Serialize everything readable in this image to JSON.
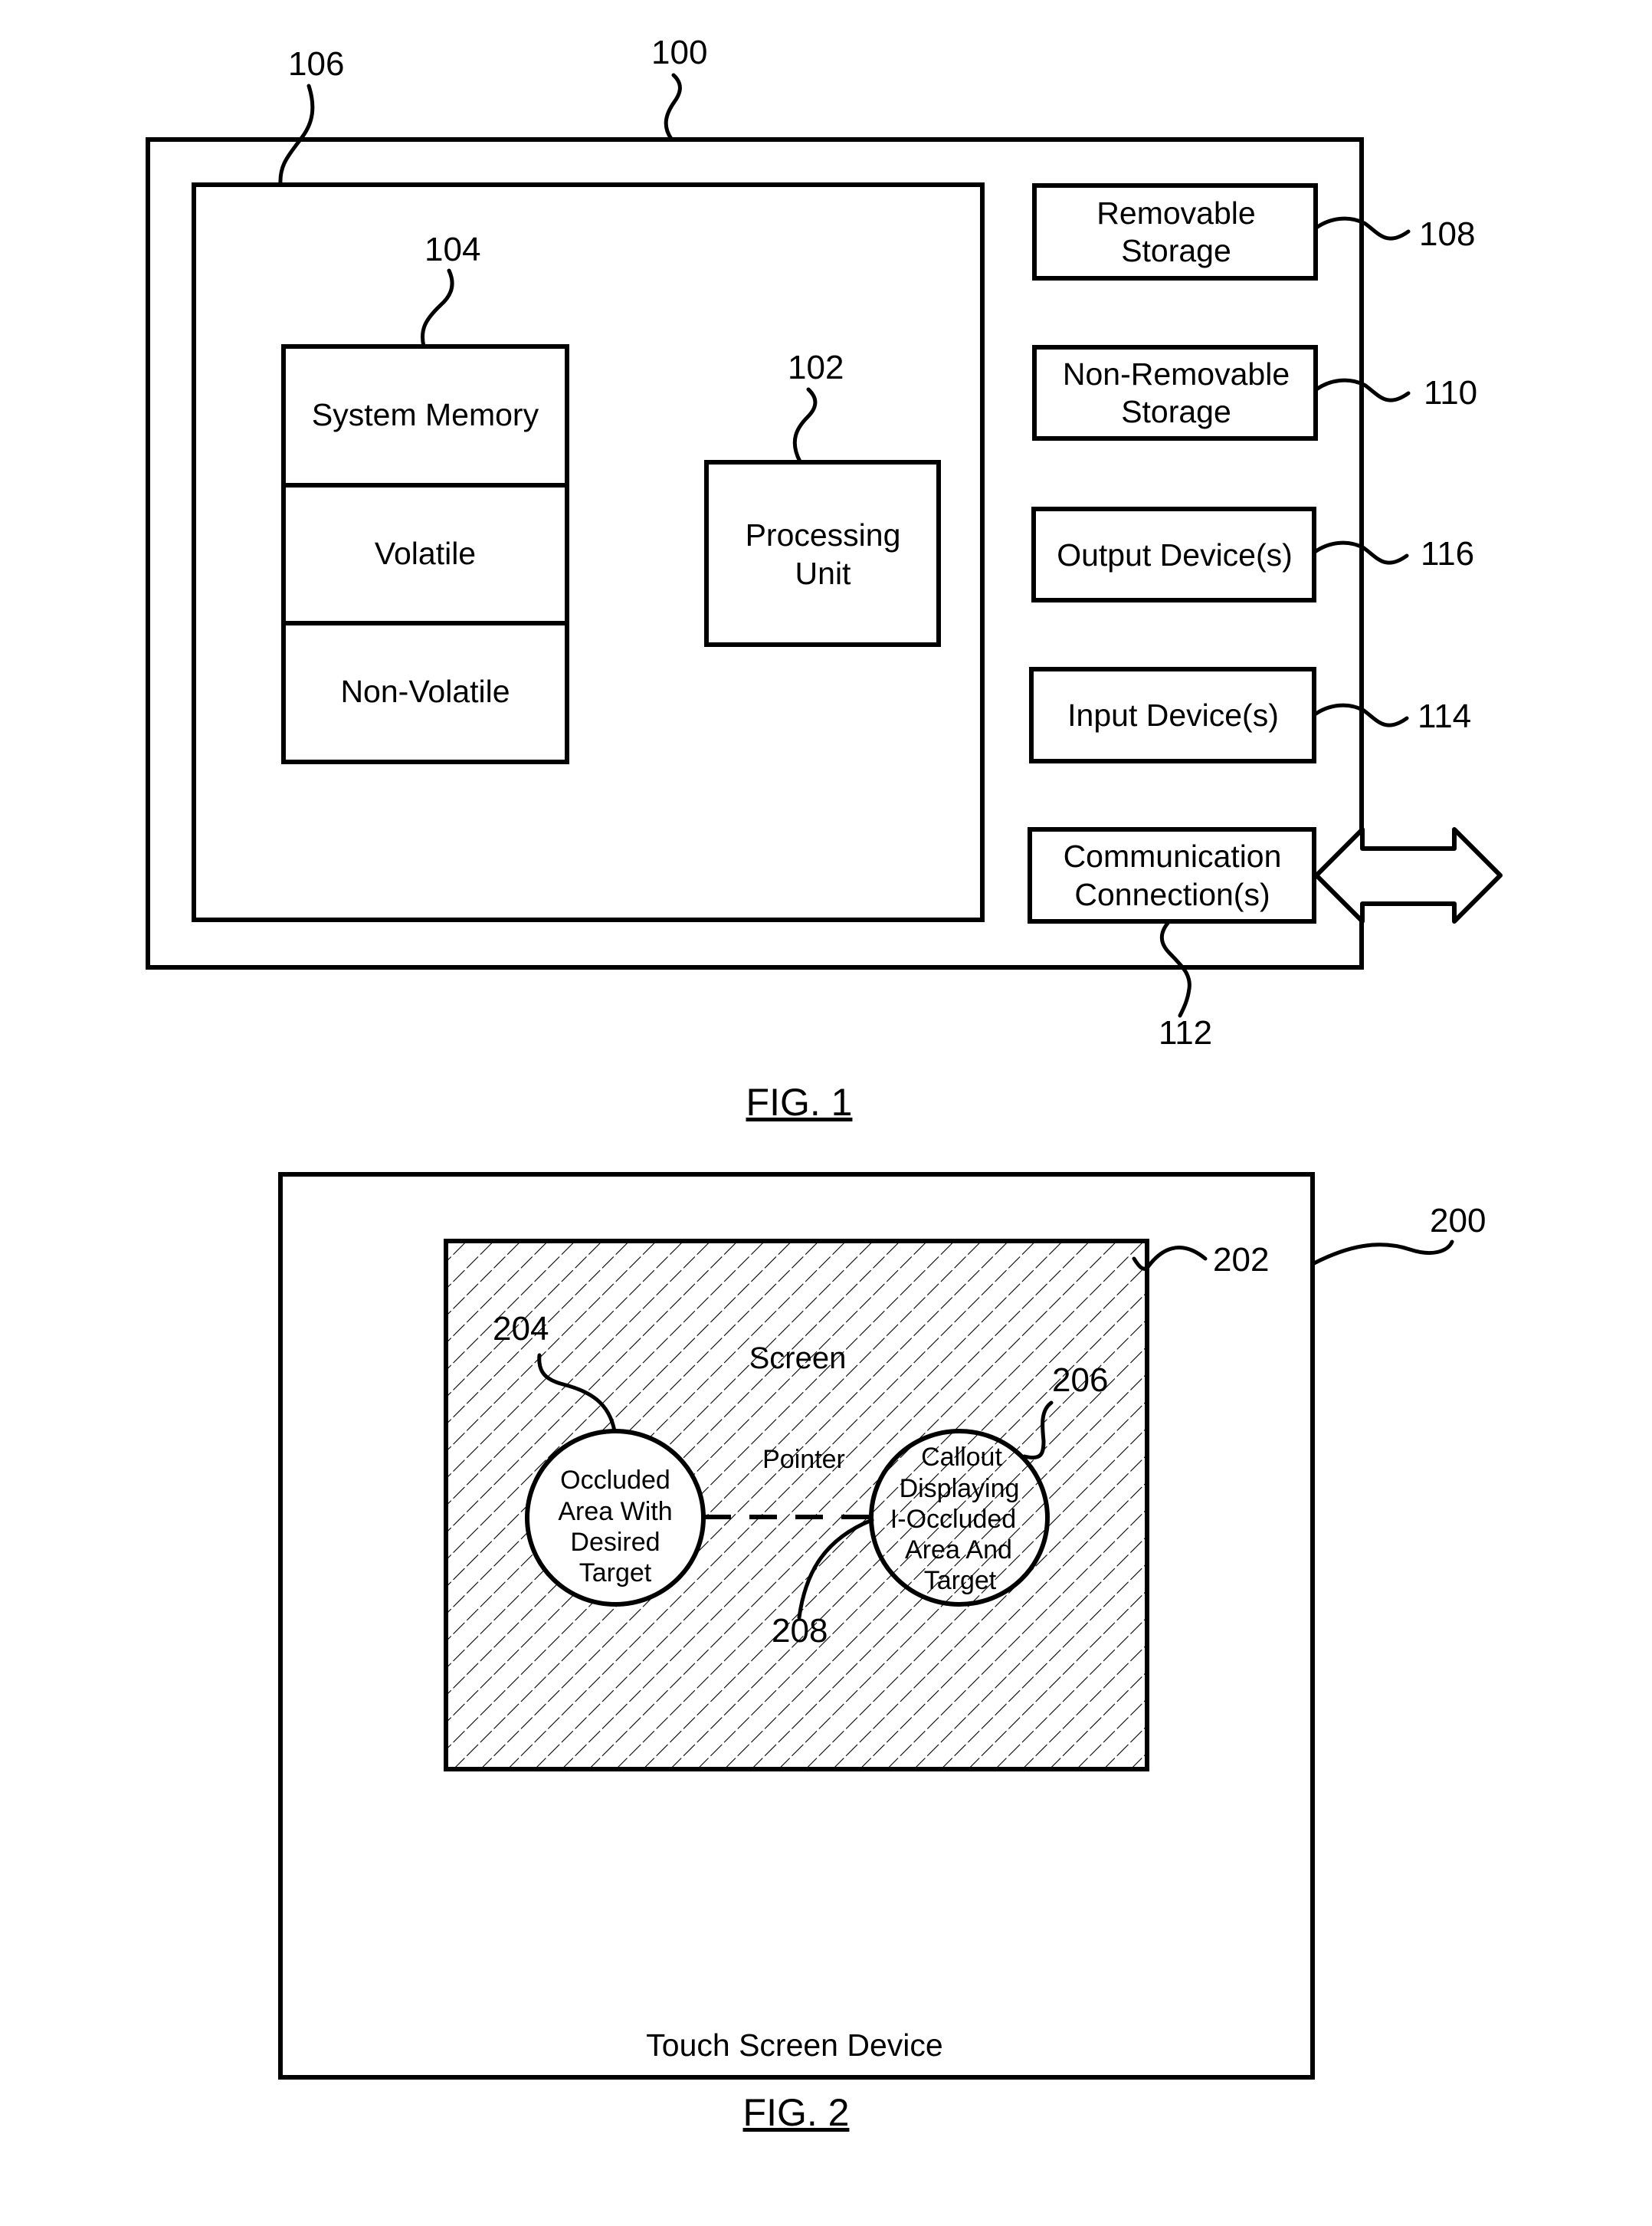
{
  "figure1": {
    "caption": "FIG. 1",
    "refs": {
      "device": "100",
      "processing_unit": "102",
      "system_memory": "104",
      "basic_config": "106",
      "removable_storage": "108",
      "non_removable_storage": "110",
      "communication_connections": "112",
      "input_devices": "114",
      "output_devices": "116"
    },
    "system_memory": {
      "label": "System Memory",
      "sections": [
        "Volatile",
        "Non-Volatile"
      ]
    },
    "processing_unit": {
      "lines": [
        "Processing",
        "Unit"
      ]
    },
    "peripherals": [
      {
        "id": "108",
        "lines": [
          "Removable",
          "Storage"
        ]
      },
      {
        "id": "110",
        "lines": [
          "Non-Removable",
          "Storage"
        ]
      },
      {
        "id": "116",
        "lines": [
          "Output Device(s)"
        ]
      },
      {
        "id": "114",
        "lines": [
          "Input Device(s)"
        ]
      },
      {
        "id": "112",
        "lines": [
          "Communication",
          "Connection(s)"
        ]
      }
    ]
  },
  "figure2": {
    "caption": "FIG. 2",
    "device_label": "Touch Screen Device",
    "screen_label": "Screen",
    "pointer_label": "Pointer",
    "refs": {
      "device": "200",
      "screen": "202",
      "occluded_area": "204",
      "callout": "206",
      "pointer": "208"
    },
    "occluded_area": {
      "lines": [
        "Occluded",
        "Area With",
        "Desired",
        "Target"
      ]
    },
    "callout": {
      "lines": [
        "Callout",
        "Displaying",
        "I-Occluded",
        "Area And",
        "Target"
      ]
    }
  }
}
